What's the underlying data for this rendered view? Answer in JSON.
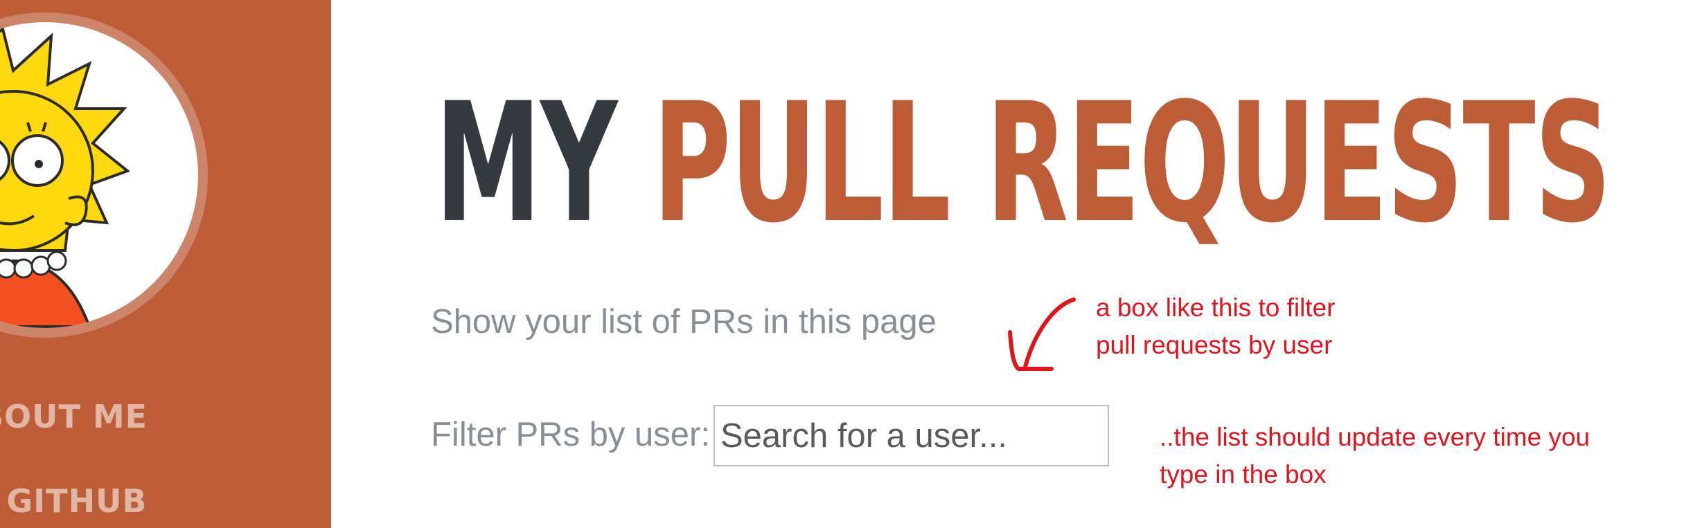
{
  "sidebar": {
    "nav": [
      {
        "label": "BOUT ME"
      },
      {
        "label": "Y GITHUB"
      }
    ]
  },
  "header": {
    "title_part1": "MY",
    "title_part2": "PULL REQUESTS",
    "subtitle": "Show your list of PRs in this page"
  },
  "filter": {
    "label": "Filter PRs by user:",
    "placeholder": "Search for a user..."
  },
  "annotations": {
    "note1": "a box like this to filter\npull requests by user",
    "note2": "..the list should update every time you\ntype in the box"
  },
  "colors": {
    "accent": "#bd5d38",
    "dark": "#343a40",
    "muted": "#868e96",
    "annotation": "#e0141c"
  }
}
